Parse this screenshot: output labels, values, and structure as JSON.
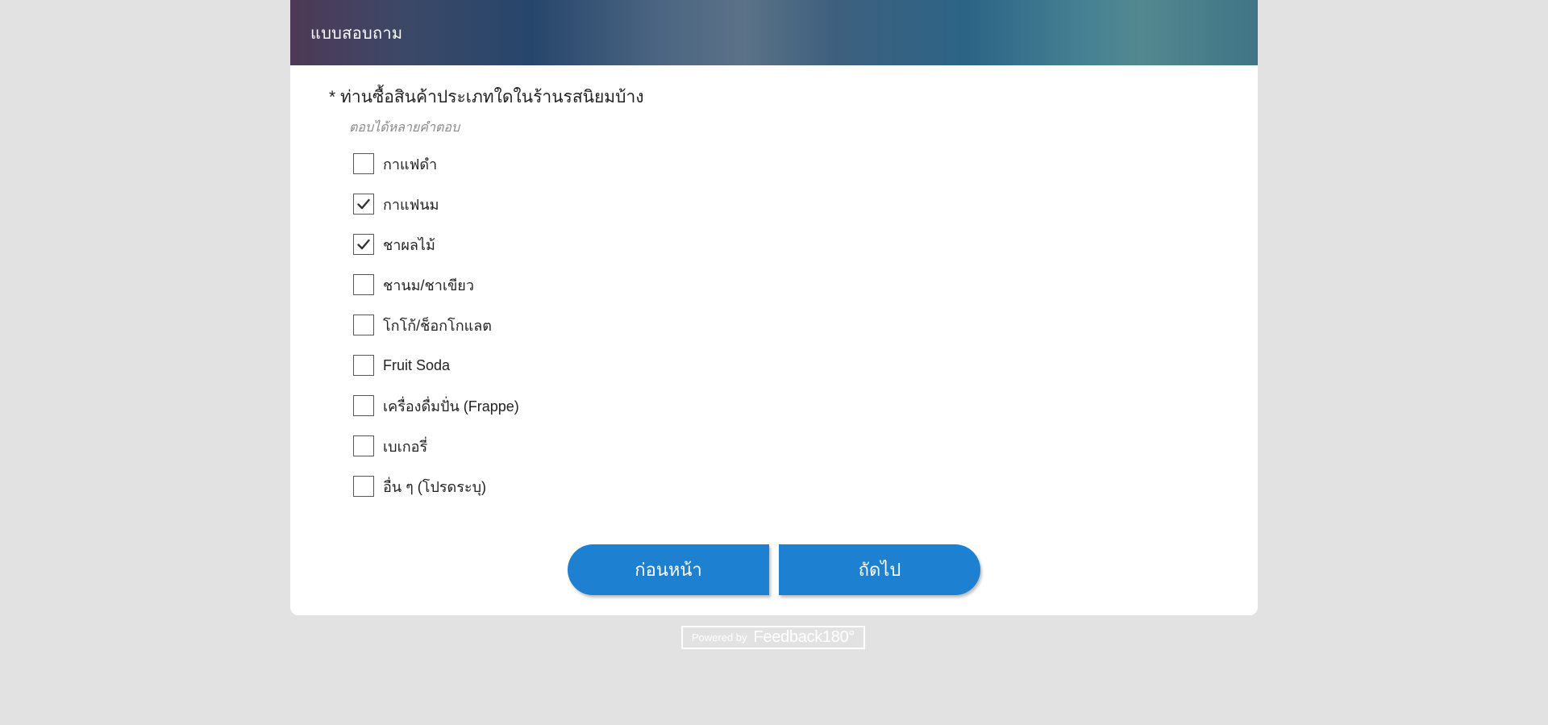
{
  "header": {
    "title": "แบบสอบถาม"
  },
  "question": {
    "text": "* ท่านซื้อสินค้าประเภทใดในร้านรสนิยมบ้าง",
    "hint": "ตอบได้หลายคำตอบ",
    "options": [
      {
        "label": "กาแฟดำ",
        "checked": false
      },
      {
        "label": "กาแฟนม",
        "checked": true
      },
      {
        "label": "ชาผลไม้",
        "checked": true
      },
      {
        "label": "ชานม/ชาเขียว",
        "checked": false
      },
      {
        "label": "โกโก้/ช็อกโกแลต",
        "checked": false
      },
      {
        "label": "Fruit Soda",
        "checked": false
      },
      {
        "label": "เครื่องดื่มปั่น (Frappe)",
        "checked": false
      },
      {
        "label": "เบเกอรี่",
        "checked": false
      },
      {
        "label": "อื่น ๆ (โปรดระบุ)",
        "checked": false
      }
    ]
  },
  "nav": {
    "prev_label": "ก่อนหน้า",
    "next_label": "ถัดไป"
  },
  "footer": {
    "powered_by": "Powered by",
    "brand": "Feedback180°"
  },
  "colors": {
    "button": "#1e80d1",
    "background": "#e2e2e2"
  },
  "icons": {
    "check": "check-icon"
  }
}
